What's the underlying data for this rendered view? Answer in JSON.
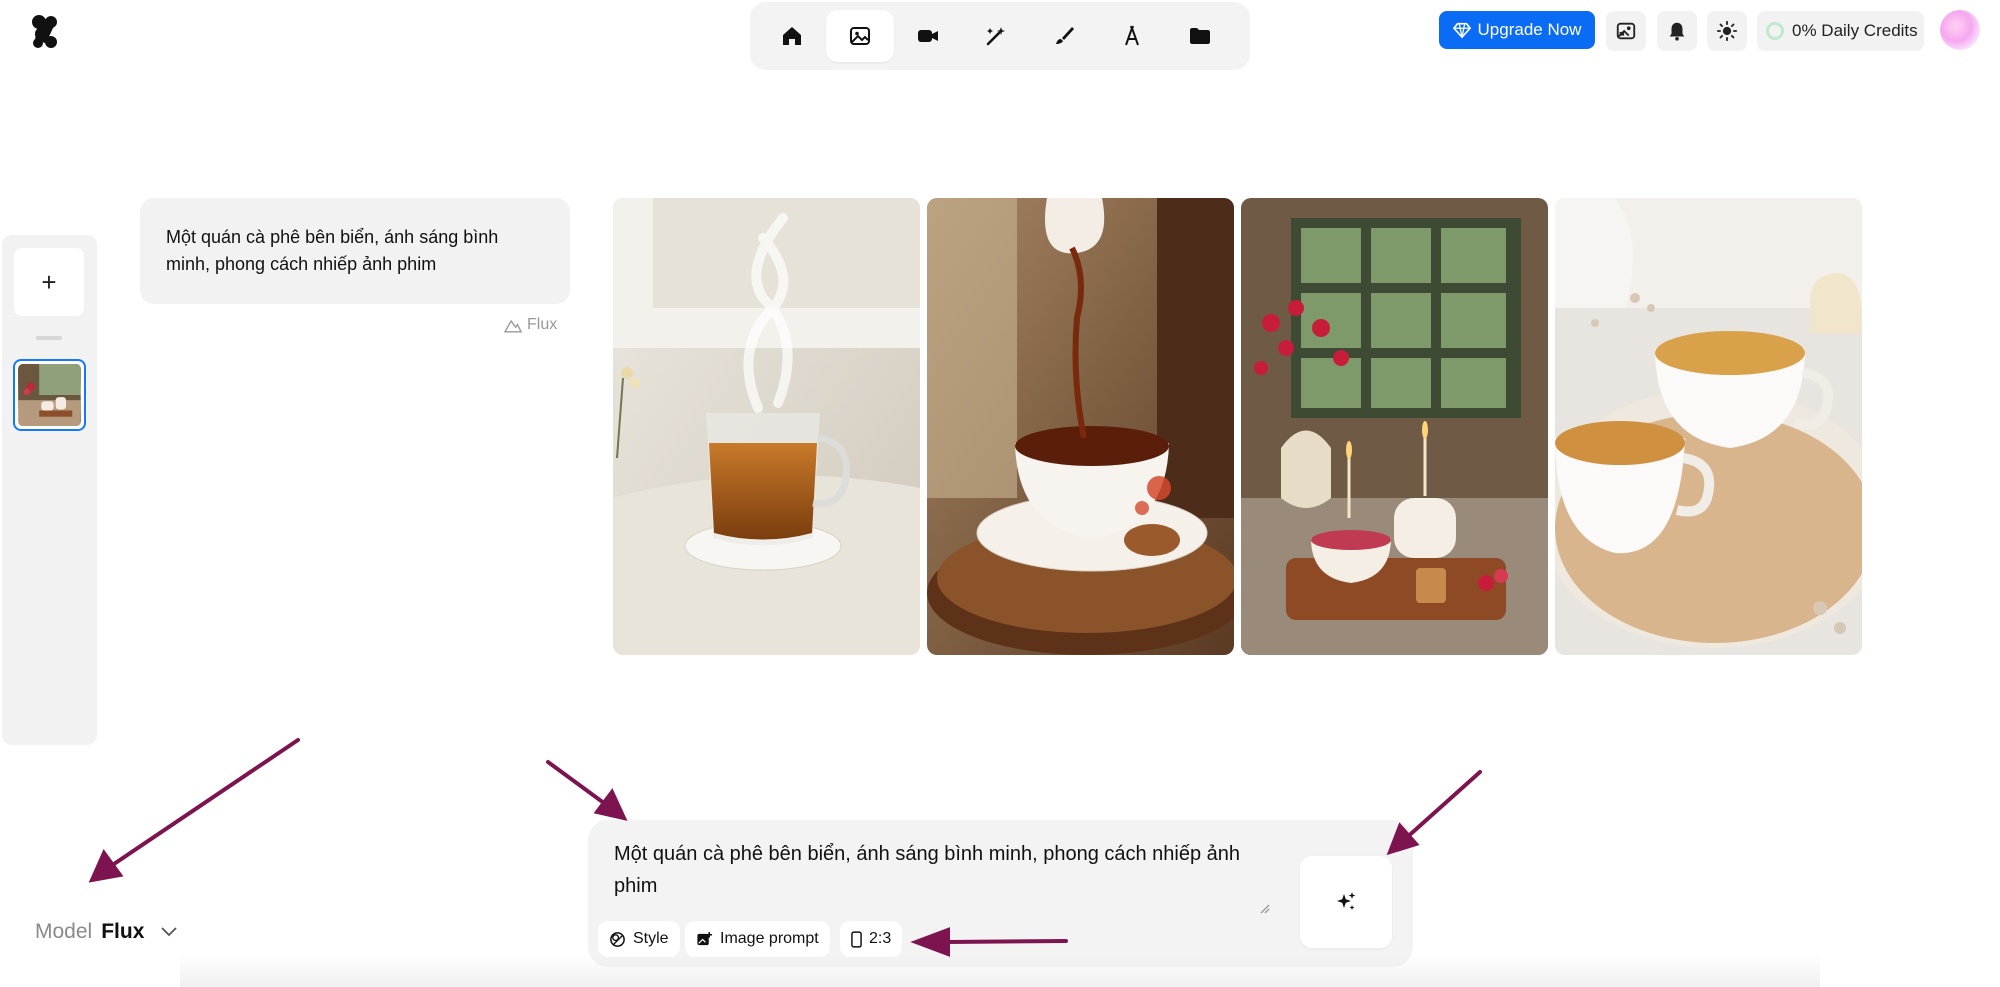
{
  "app": {
    "nav": [
      {
        "name": "home",
        "icon": "home-icon"
      },
      {
        "name": "image",
        "icon": "image-icon",
        "active": true
      },
      {
        "name": "video",
        "icon": "video-icon"
      },
      {
        "name": "magic",
        "icon": "magic-wand-icon"
      },
      {
        "name": "edit",
        "icon": "brush-icon"
      },
      {
        "name": "font",
        "icon": "font-icon"
      },
      {
        "name": "folder",
        "icon": "folder-icon"
      }
    ]
  },
  "header": {
    "upgrade_label": "Upgrade Now",
    "credits_label": "0% Daily Credits",
    "colors": {
      "accent": "#0a6cf5",
      "arrow": "#7d1450"
    }
  },
  "history": {
    "prompt": "Một quán cà phê bên biển, ánh sáng bình minh, phong cách nhiếp ảnh phim",
    "model_tag": "Flux"
  },
  "gallery": {
    "images": [
      {
        "name": "glass-tea-cup-steam"
      },
      {
        "name": "pouring-tea-porcelain-cup"
      },
      {
        "name": "tea-set-candles-window"
      },
      {
        "name": "tea-cups-wooden-tray"
      }
    ]
  },
  "composer": {
    "prompt_value": "Một quán cà phê bên biển, ánh sáng bình minh, phong cách nhiếp ảnh phim",
    "style_label": "Style",
    "image_prompt_label": "Image prompt",
    "aspect_label": "2:3"
  },
  "model": {
    "label": "Model",
    "value": "Flux"
  }
}
